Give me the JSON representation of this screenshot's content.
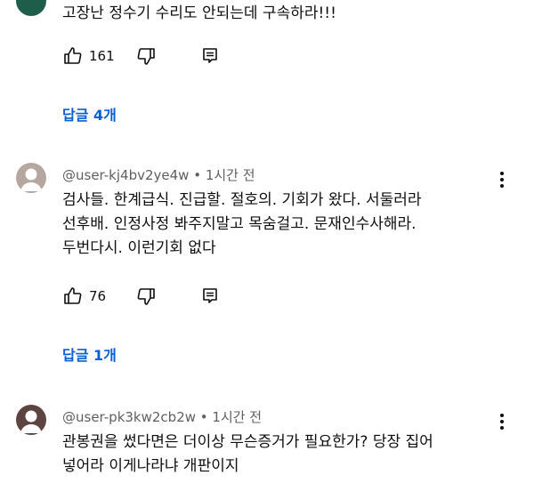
{
  "comments": [
    {
      "handle": "",
      "time": "",
      "lines": [
        "고장난 정수기  수리도 안되는데 구속하라!!!"
      ],
      "likes": "161",
      "replies_label": "답글 4개"
    },
    {
      "handle": "@user-kj4bv2ye4w",
      "time": "• 1시간 전",
      "lines": [
        "검사들. 한계급식.  진급할. 절호의. 기회가 왔다. 서둘러라",
        "선후배. 인정사정 봐주지말고  목숨걸고. 문재인수사해라.",
        "두번다시. 이런기회 없다"
      ],
      "likes": "76",
      "replies_label": "답글 1개"
    },
    {
      "handle": "@user-pk3kw2cb2w",
      "time": "• 1시간 전",
      "lines": [
        "관봉권을 썼다면은 더이상 무슨증거가 필요한가? 당장 집어",
        "넣어라 이게나라냐 개판이지"
      ],
      "likes": "",
      "replies_label": ""
    }
  ],
  "icons": {
    "like": "thumbs-up-icon",
    "dislike": "thumbs-down-icon",
    "reply": "reply-comment-icon",
    "menu": "more-vert-icon"
  },
  "colors": {
    "text": "#0f0f0f",
    "meta": "#606060",
    "link": "#065fd4",
    "avatar_top": "#1e5d4a",
    "avatar_gray": "#b6a6a0",
    "avatar_dark": "#5c4541"
  }
}
